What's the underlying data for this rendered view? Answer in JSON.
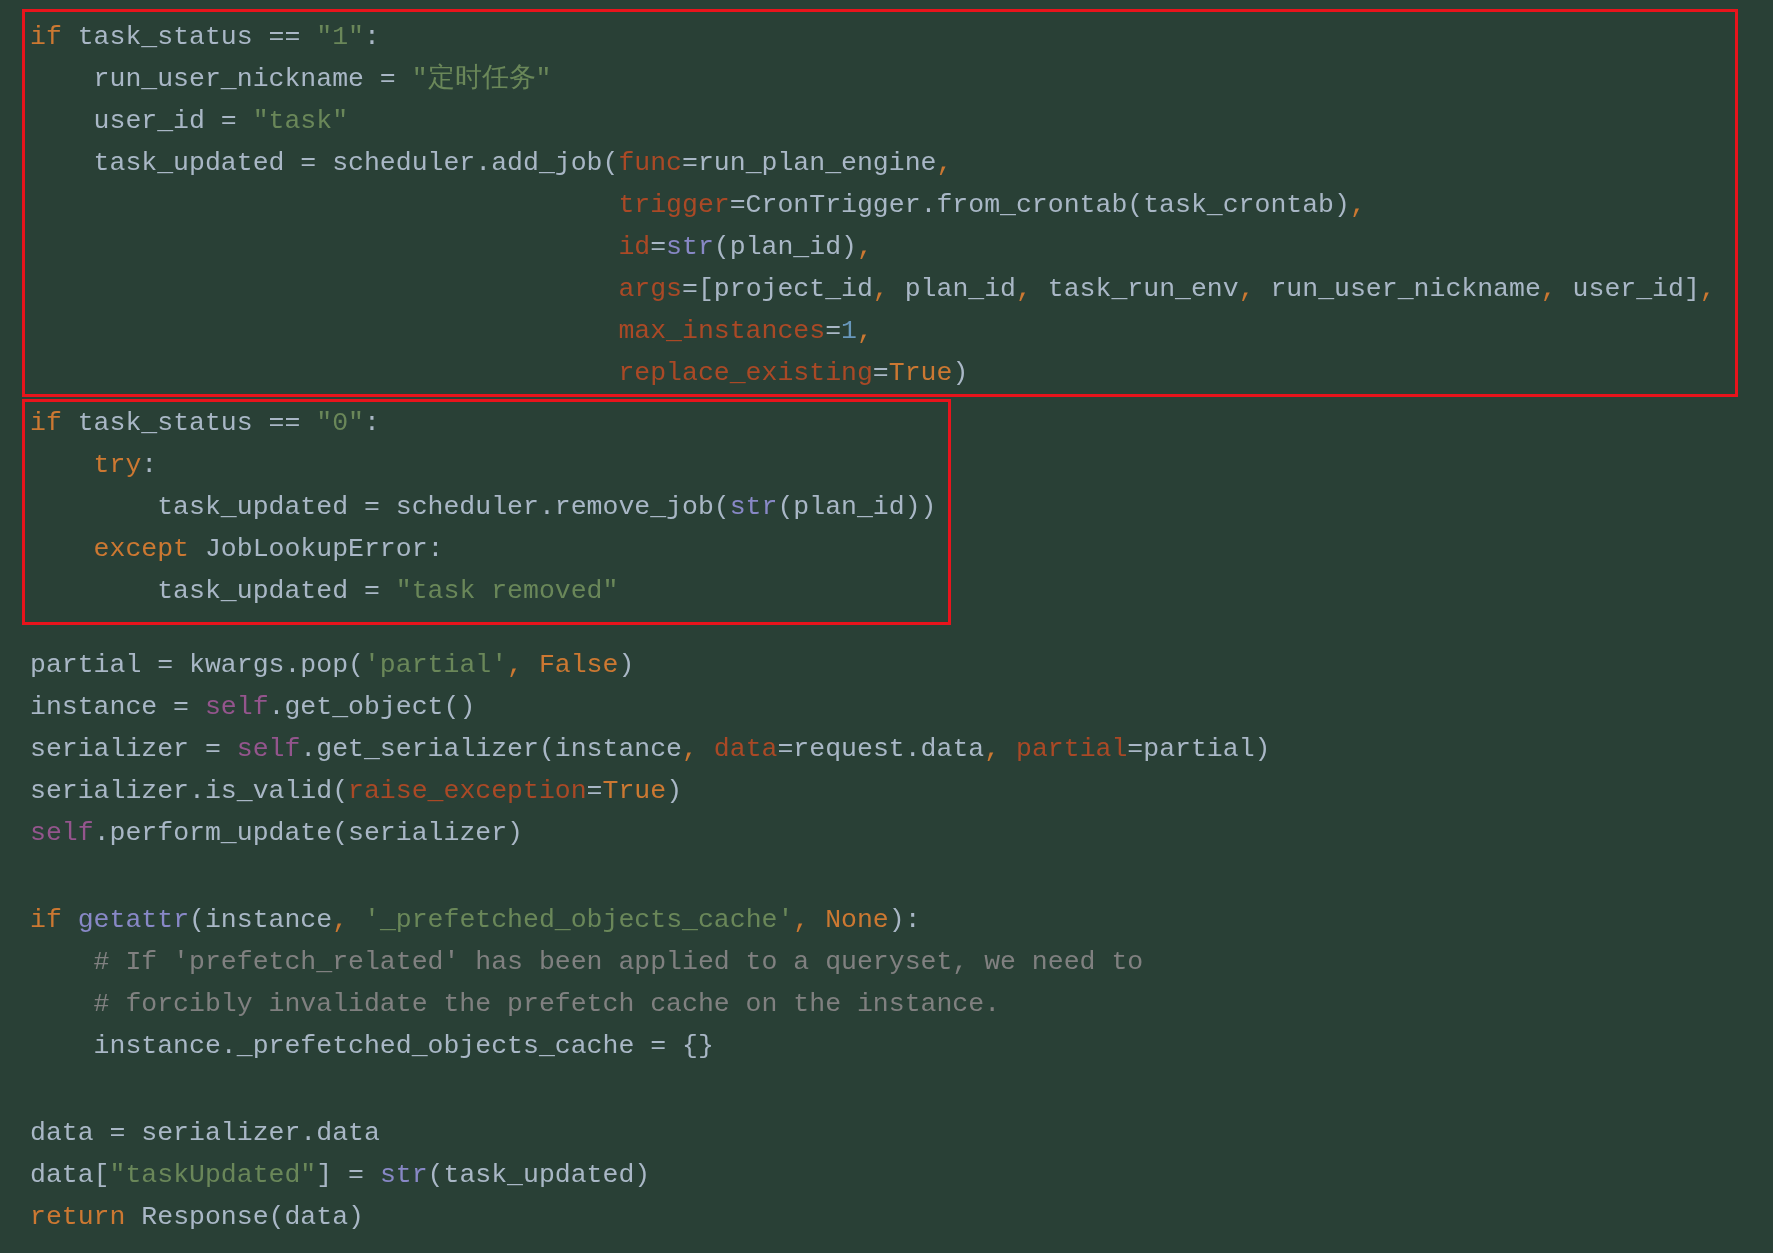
{
  "blocks": [
    {
      "highlighted": true,
      "lines": [
        [
          {
            "kind": "keyword",
            "text": "if"
          },
          {
            "kind": "plain",
            "text": " task_status == "
          },
          {
            "kind": "string",
            "text": "\"1\""
          },
          {
            "kind": "plain",
            "text": ":"
          }
        ],
        [
          {
            "kind": "plain",
            "text": "    run_user_nickname = "
          },
          {
            "kind": "string",
            "text": "\"定时任务\""
          }
        ],
        [
          {
            "kind": "plain",
            "text": "    user_id = "
          },
          {
            "kind": "string",
            "text": "\"task\""
          }
        ],
        [
          {
            "kind": "plain",
            "text": "    task_updated = scheduler.add_job("
          },
          {
            "kind": "param",
            "text": "func"
          },
          {
            "kind": "plain",
            "text": "=run_plan_engine"
          },
          {
            "kind": "keyword",
            "text": ","
          }
        ],
        [
          {
            "kind": "param",
            "text": "                                     trigger"
          },
          {
            "kind": "plain",
            "text": "=CronTrigger.from_crontab(task_crontab)"
          },
          {
            "kind": "keyword",
            "text": ","
          }
        ],
        [
          {
            "kind": "param",
            "text": "                                     id"
          },
          {
            "kind": "plain",
            "text": "="
          },
          {
            "kind": "builtin",
            "text": "str"
          },
          {
            "kind": "plain",
            "text": "(plan_id)"
          },
          {
            "kind": "keyword",
            "text": ","
          }
        ],
        [
          {
            "kind": "param",
            "text": "                                     args"
          },
          {
            "kind": "plain",
            "text": "=[project_id"
          },
          {
            "kind": "keyword",
            "text": ","
          },
          {
            "kind": "plain",
            "text": " plan_id"
          },
          {
            "kind": "keyword",
            "text": ","
          },
          {
            "kind": "plain",
            "text": " task_run_env"
          },
          {
            "kind": "keyword",
            "text": ","
          },
          {
            "kind": "plain",
            "text": " run_user_nickname"
          },
          {
            "kind": "keyword",
            "text": ","
          },
          {
            "kind": "plain",
            "text": " user_id]"
          },
          {
            "kind": "keyword",
            "text": ","
          }
        ],
        [
          {
            "kind": "param",
            "text": "                                     max_instances"
          },
          {
            "kind": "plain",
            "text": "="
          },
          {
            "kind": "number",
            "text": "1"
          },
          {
            "kind": "keyword",
            "text": ","
          }
        ],
        [
          {
            "kind": "param",
            "text": "                                     replace_existing"
          },
          {
            "kind": "plain",
            "text": "="
          },
          {
            "kind": "keyword",
            "text": "True"
          },
          {
            "kind": "plain",
            "text": ")"
          }
        ]
      ]
    },
    {
      "highlighted": true,
      "lines": [
        [
          {
            "kind": "keyword",
            "text": "if"
          },
          {
            "kind": "plain",
            "text": " task_status == "
          },
          {
            "kind": "string",
            "text": "\"0\""
          },
          {
            "kind": "plain",
            "text": ":"
          }
        ],
        [
          {
            "kind": "keyword",
            "text": "    try"
          },
          {
            "kind": "plain",
            "text": ":"
          }
        ],
        [
          {
            "kind": "plain",
            "text": "        task_updated = scheduler.remove_job("
          },
          {
            "kind": "builtin",
            "text": "str"
          },
          {
            "kind": "plain",
            "text": "(plan_id))"
          }
        ],
        [
          {
            "kind": "keyword",
            "text": "    except"
          },
          {
            "kind": "plain",
            "text": " JobLookupError:"
          }
        ],
        [
          {
            "kind": "plain",
            "text": "        task_updated = "
          },
          {
            "kind": "string",
            "text": "\"task removed\""
          }
        ]
      ]
    },
    {
      "highlighted": false,
      "lines": [
        [
          {
            "kind": "plain",
            "text": "partial = kwargs.pop("
          },
          {
            "kind": "string",
            "text": "'partial'"
          },
          {
            "kind": "keyword",
            "text": ", False"
          },
          {
            "kind": "plain",
            "text": ")"
          }
        ],
        [
          {
            "kind": "plain",
            "text": "instance = "
          },
          {
            "kind": "self",
            "text": "self"
          },
          {
            "kind": "plain",
            "text": ".get_object()"
          }
        ],
        [
          {
            "kind": "plain",
            "text": "serializer = "
          },
          {
            "kind": "self",
            "text": "self"
          },
          {
            "kind": "plain",
            "text": ".get_serializer(instance"
          },
          {
            "kind": "keyword",
            "text": ", "
          },
          {
            "kind": "param",
            "text": "data"
          },
          {
            "kind": "plain",
            "text": "=request.data"
          },
          {
            "kind": "keyword",
            "text": ", "
          },
          {
            "kind": "param",
            "text": "partial"
          },
          {
            "kind": "plain",
            "text": "=partial)"
          }
        ],
        [
          {
            "kind": "plain",
            "text": "serializer.is_valid("
          },
          {
            "kind": "param",
            "text": "raise_exception"
          },
          {
            "kind": "plain",
            "text": "="
          },
          {
            "kind": "keyword",
            "text": "True"
          },
          {
            "kind": "plain",
            "text": ")"
          }
        ],
        [
          {
            "kind": "self",
            "text": "self"
          },
          {
            "kind": "plain",
            "text": ".perform_update(serializer)"
          }
        ]
      ]
    },
    {
      "highlighted": false,
      "lines": [
        [
          {
            "kind": "keyword",
            "text": "if "
          },
          {
            "kind": "builtin",
            "text": "getattr"
          },
          {
            "kind": "plain",
            "text": "(instance"
          },
          {
            "kind": "keyword",
            "text": ", "
          },
          {
            "kind": "string",
            "text": "'_prefetched_objects_cache'"
          },
          {
            "kind": "keyword",
            "text": ", None"
          },
          {
            "kind": "plain",
            "text": "):"
          }
        ],
        [
          {
            "kind": "comment",
            "text": "    # If 'prefetch_related' has been applied to a queryset, we need to"
          }
        ],
        [
          {
            "kind": "comment",
            "text": "    # forcibly invalidate the prefetch cache on the instance."
          }
        ],
        [
          {
            "kind": "plain",
            "text": "    instance._prefetched_objects_cache = {}"
          }
        ]
      ]
    },
    {
      "highlighted": false,
      "lines": [
        [
          {
            "kind": "plain",
            "text": "data = serializer.data"
          }
        ],
        [
          {
            "kind": "plain",
            "text": "data["
          },
          {
            "kind": "string",
            "text": "\"taskUpdated\""
          },
          {
            "kind": "plain",
            "text": "] = "
          },
          {
            "kind": "builtin",
            "text": "str"
          },
          {
            "kind": "plain",
            "text": "(task_updated)"
          }
        ],
        [
          {
            "kind": "keyword",
            "text": "return"
          },
          {
            "kind": "plain",
            "text": " Response(data)"
          }
        ]
      ]
    }
  ]
}
